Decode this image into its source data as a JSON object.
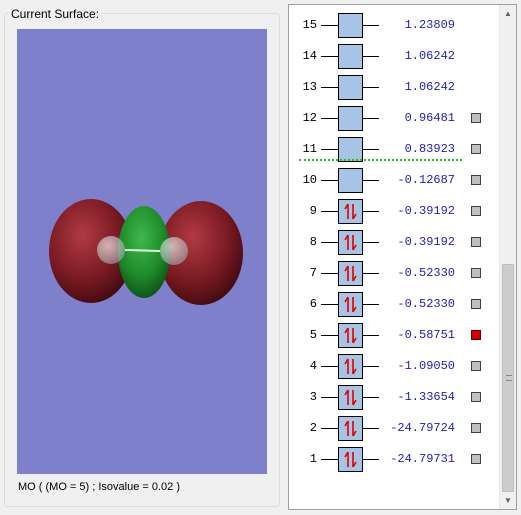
{
  "surface_group": {
    "title": "Current Surface:",
    "caption": "MO ( (MO = 5) ; Isovalue = 0.02 )",
    "background_color": "#7f80cc",
    "lobe_colors": {
      "positive": "#1e8a2a",
      "negative": "#7a1a22"
    }
  },
  "mo_list": {
    "orbitals": [
      {
        "number": "15",
        "energy": "1.23809",
        "occupied": false,
        "has_checkbox": false,
        "selected": false
      },
      {
        "number": "14",
        "energy": "1.06242",
        "occupied": false,
        "has_checkbox": false,
        "selected": false
      },
      {
        "number": "13",
        "energy": "1.06242",
        "occupied": false,
        "has_checkbox": false,
        "selected": false
      },
      {
        "number": "12",
        "energy": "0.96481",
        "occupied": false,
        "has_checkbox": true,
        "selected": false
      },
      {
        "number": "11",
        "energy": "0.83923",
        "occupied": false,
        "has_checkbox": true,
        "selected": false
      },
      {
        "number": "10",
        "energy": "-0.12687",
        "occupied": false,
        "has_checkbox": true,
        "selected": false
      },
      {
        "number": "9",
        "energy": "-0.39192",
        "occupied": true,
        "has_checkbox": true,
        "selected": false
      },
      {
        "number": "8",
        "energy": "-0.39192",
        "occupied": true,
        "has_checkbox": true,
        "selected": false
      },
      {
        "number": "7",
        "energy": "-0.52330",
        "occupied": true,
        "has_checkbox": true,
        "selected": false
      },
      {
        "number": "6",
        "energy": "-0.52330",
        "occupied": true,
        "has_checkbox": true,
        "selected": false
      },
      {
        "number": "5",
        "energy": "-0.58751",
        "occupied": true,
        "has_checkbox": true,
        "selected": true
      },
      {
        "number": "4",
        "energy": "-1.09050",
        "occupied": true,
        "has_checkbox": true,
        "selected": false
      },
      {
        "number": "3",
        "energy": "-1.33654",
        "occupied": true,
        "has_checkbox": true,
        "selected": false
      },
      {
        "number": "2",
        "energy": "-24.79724",
        "occupied": true,
        "has_checkbox": true,
        "selected": false
      },
      {
        "number": "1",
        "energy": "-24.79731",
        "occupied": true,
        "has_checkbox": true,
        "selected": false
      }
    ],
    "homo_lumo_separator_color": "#1fc01f",
    "box_color": "#a8c4e4",
    "electron_arrow_color": "#e00000",
    "energy_text_color": "#1d1dc0",
    "selected_checkbox_color": "#d40000"
  },
  "scrollbar": {
    "up_icon": "scroll-up-arrow-icon",
    "down_icon": "scroll-down-arrow-icon"
  }
}
